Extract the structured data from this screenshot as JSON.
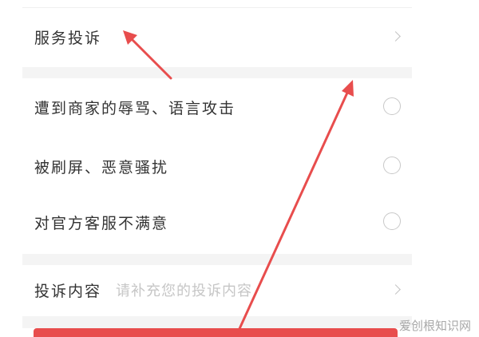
{
  "complaint_form": {
    "service_complaint": {
      "label": "服务投诉"
    },
    "reasons": [
      {
        "label": "遭到商家的辱骂、语言攻击",
        "selected": false
      },
      {
        "label": "被刷屏、恶意骚扰",
        "selected": false
      },
      {
        "label": "对官方客服不满意",
        "selected": false
      }
    ],
    "content": {
      "label": "投诉内容",
      "placeholder": "请补充您的投诉内容"
    }
  },
  "annotation": {
    "arrow_color": "#e84d4d"
  },
  "watermark": {
    "text": "爱创根知识网"
  },
  "colors": {
    "accent": "#e84d4d",
    "separator": "#f4f4f4",
    "text": "#333333",
    "placeholder": "#c6c6c6"
  }
}
